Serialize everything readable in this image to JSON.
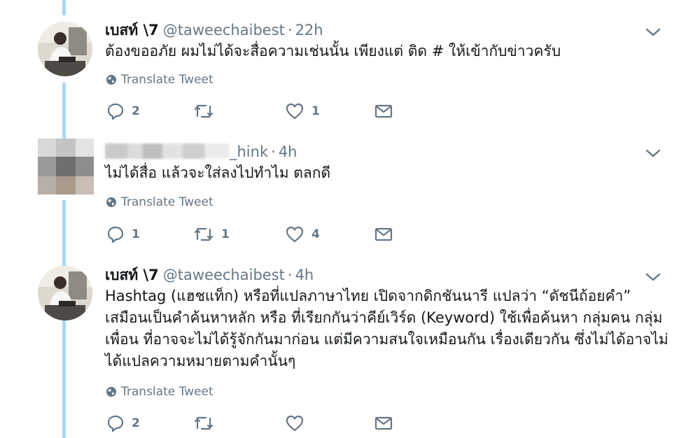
{
  "tweets": [
    {
      "display_name": "เบสท์ \\7",
      "handle": "@taweechaibest",
      "separator": "·",
      "time": "22h",
      "text": "ต้องขออภัย ผมไม่ได้จะสื่อความเช่นนั้น เพียงแต่ ติด # ให้เข้ากับข่าวครับ",
      "translate_label": "Translate Tweet",
      "replies": "2",
      "retweets": "",
      "likes": "1"
    },
    {
      "display_name": "",
      "handle": "_hink",
      "separator": "·",
      "time": "4h",
      "text": "ไม่ได้สื่อ แล้วจะใส่ลงไปทำไม ตลกดี",
      "translate_label": "Translate Tweet",
      "replies": "1",
      "retweets": "1",
      "likes": "4"
    },
    {
      "display_name": "เบสท์ \\7",
      "handle": "@taweechaibest",
      "separator": "·",
      "time": "4h",
      "text": "Hashtag (แฮชแท็ก) หรือที่แปลภาษาไทย เปิดจากดิกชันนารี แปลว่า “ดัชนีถ้อยคำ” เสมือนเป็นคำค้นหาหลัก หรือ ที่เรียกกันว่าคีย์เวิร์ด (Keyword) ใช้เพื่อค้นหา กลุ่มคน กลุ่มเพื่อน ที่อาจจะไม่ได้รู้จักกันมาก่อน แต่มีความสนใจเหมือนกัน เรื่องเดียวกัน ซึ่งไม่ได้อาจไม่ได้แปลความหมายตามคำนั้นๆ",
      "translate_label": "Translate Tweet",
      "replies": "2",
      "retweets": "",
      "likes": ""
    }
  ],
  "colors": {
    "thread_line": "#a6d8f5",
    "text": "#14171a",
    "secondary": "#657786"
  },
  "icons": {
    "reply": "reply-icon",
    "retweet": "retweet-icon",
    "like": "heart-icon",
    "dm": "envelope-icon",
    "more": "chevron-down-icon",
    "translate": "globe-icon"
  }
}
